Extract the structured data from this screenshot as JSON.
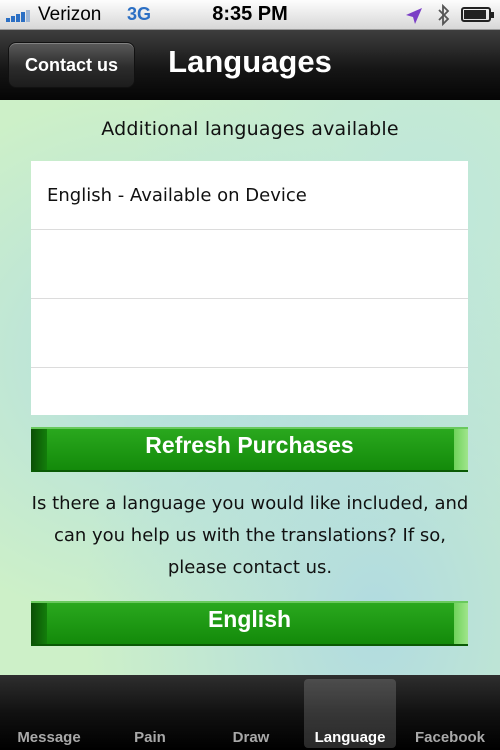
{
  "status_bar": {
    "carrier": "Verizon",
    "network": "3G",
    "time": "8:35 PM"
  },
  "nav_bar": {
    "back_button": "Contact us",
    "title": "Languages"
  },
  "content": {
    "heading": "Additional languages available",
    "languages": [
      "English - Available on Device",
      "",
      "",
      ""
    ],
    "refresh_button": "Refresh Purchases",
    "info_text": "Is there a language you would like included, and can you help us with the translations?  If so, please contact us.",
    "language_button": "English"
  },
  "tab_bar": {
    "tabs": [
      {
        "label": "Message"
      },
      {
        "label": "Pain"
      },
      {
        "label": "Draw"
      },
      {
        "label": "Language"
      },
      {
        "label": "Facebook"
      }
    ],
    "active": "Language"
  },
  "colors": {
    "accent_green": "#138a0a",
    "network_blue": "#2b6fc4",
    "content_bg": "#cdf0c8"
  }
}
